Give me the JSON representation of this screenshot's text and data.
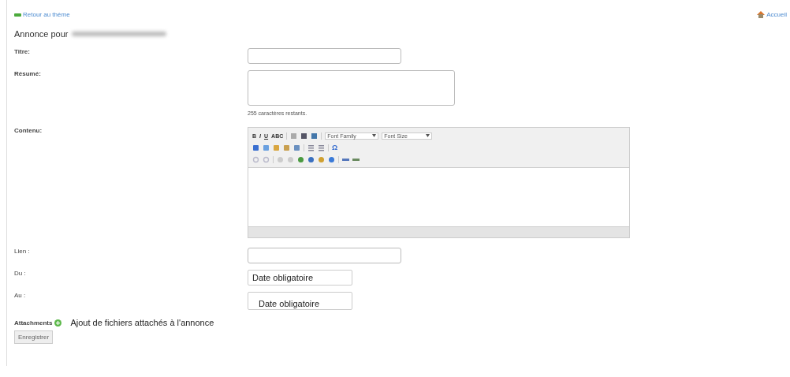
{
  "top_links": {
    "back": "Retour au thème",
    "home": "Accueil"
  },
  "heading": "Annonce pour",
  "fields": [
    {
      "kind": "text",
      "label": "Titre:"
    },
    {
      "kind": "textarea",
      "label": "Résumé:",
      "hint": "255 caractères restants."
    },
    {
      "kind": "editor",
      "label": "Contenu:"
    },
    {
      "kind": "text",
      "label": "Lien :"
    },
    {
      "kind": "date",
      "label": "Du :",
      "value": "Date obligatoire"
    },
    {
      "kind": "date2",
      "label": "Au :",
      "value": "Date obligatoire"
    }
  ],
  "editor": {
    "format_buttons": [
      "B",
      "I",
      "U",
      "ABC"
    ],
    "font_family": "Font Family",
    "font_size": "Font Size",
    "special_char": "Ω"
  },
  "attachments": {
    "label": "Attachments",
    "text": "Ajout de fichiers attachés à l'annonce"
  },
  "save_button": "Enregistrer"
}
